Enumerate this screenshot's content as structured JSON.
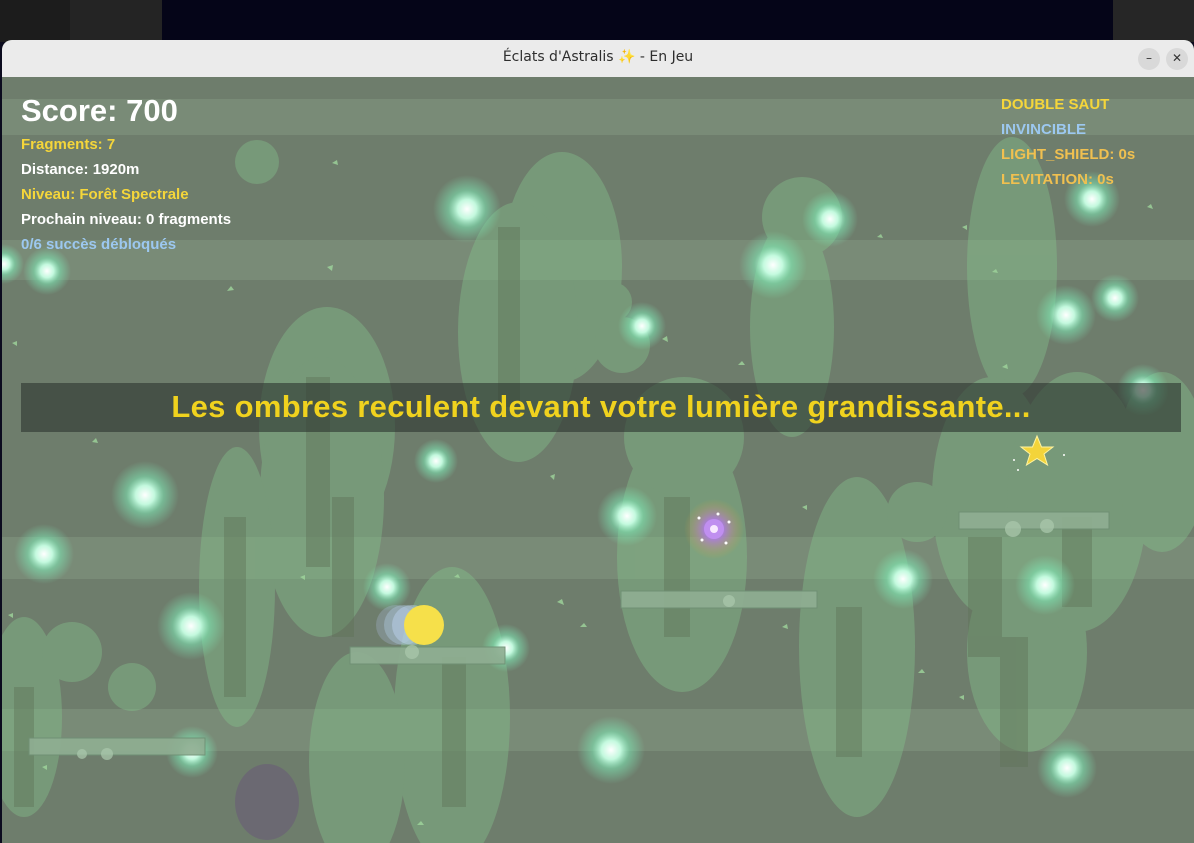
{
  "window": {
    "title": "Éclats d'Astralis ✨ - En Jeu",
    "minimize_label": "–",
    "close_label": "✕"
  },
  "hud": {
    "score": "Score: 700",
    "fragments": "Fragments: 7",
    "distance": "Distance: 1920m",
    "niveau": "Niveau: Forêt Spectrale",
    "prochain": "Prochain niveau: 0 fragments",
    "succes": "0/6 succès débloqués"
  },
  "powerups": [
    "DOUBLE SAUT",
    "INVINCIBLE",
    "LIGHT_SHIELD: 0s",
    "LEVITATION: 0s"
  ],
  "banner": "Les ombres reculent devant votre lumière grandissante...",
  "icons": {
    "player": "player-orb",
    "star": "star-icon",
    "crystal": "crystal-gem-icon",
    "fragment": "light-fragment-orb"
  },
  "colors": {
    "player": "#f6e04a",
    "star": "#f3d43a",
    "crystal": "#b27ae0",
    "fragment_core": "#e8fff4",
    "forest_tint": "#6e7d6c",
    "banner_text": "#f0d21e"
  }
}
